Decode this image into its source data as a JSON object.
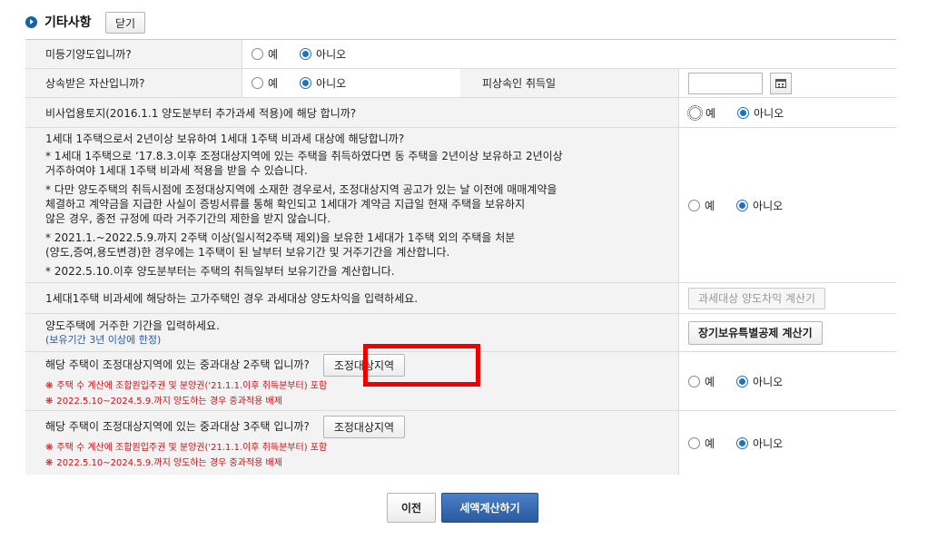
{
  "section": {
    "title": "기타사항",
    "close_label": "닫기"
  },
  "radio": {
    "yes": "예",
    "no": "아니오"
  },
  "rows": [
    {
      "question": "미등기양도입니까?",
      "selected": "no"
    },
    {
      "question": "상속받은 자산입니까?",
      "selected": "no",
      "extra_label": "피상속인 취득일",
      "date_value": ""
    },
    {
      "question": "비사업용토지(2016.1.1 양도분부터 추가과세 적용)에 해당 합니까?",
      "selected": "no"
    },
    {
      "lines": [
        "1세대 1주택으로서 2년이상 보유하여 1세대 1주택 비과세 대상에 해당합니까?",
        "* 1세대 1주택으로 ‘17.8.3.이후 조정대상지역에 있는 주택을 취득하였다면 동 주택을 2년이상 보유하고 2년이상",
        "거주하여야 1세대 1주택 비과세 적용을 받을 수 있습니다.",
        "* 다만 양도주택의 취득시점에 조정대상지역에 소재한 경우로서, 조정대상지역 공고가 있는 날 이전에 매매계약을",
        "체결하고 계약금을 지급한 사실이 증빙서류를 통해 확인되고 1세대가 계약금 지급일 현재 주택을 보유하지",
        "않은 경우, 종전 규정에 따라 거주기간의 제한을 받지 않습니다.",
        "* 2021.1.~2022.5.9.까지 2주택 이상(일시적2주택 제외)을 보유한 1세대가 1주택 외의 주택을 처분",
        "(양도,증여,용도변경)한 경우에는 1주택이 된 날부터 보유기간 및 거주기간을 계산합니다.",
        "* 2022.5.10.이후 양도분부터는 주택의 취득일부터 보유기간을 계산합니다."
      ],
      "selected": "no"
    },
    {
      "question": "1세대1주택 비과세에 해당하는 고가주택인 경우 과세대상 양도차익을 입력하세요.",
      "button": "과세대상 양도차익 계산기"
    },
    {
      "question": "양도주택에 거주한 기간을 입력하세요.",
      "note": "(보유기간 3년 이상에 한정)",
      "button": "장기보유특별공제 계산기"
    },
    {
      "question": "해당 주택이 조정대상지역에 있는 중과대상 2주택 입니까?",
      "button": "조정대상지역",
      "notes": [
        "주택 수 계산에 조합원입주권 및 분양권('21.1.1.이후 취득분부터) 포함",
        "2022.5.10~2024.5.9.까지 양도하는 경우 중과적용 배제"
      ],
      "selected": "no"
    },
    {
      "question": "해당 주택이 조정대상지역에 있는 중과대상 3주택 입니까?",
      "button": "조정대상지역",
      "notes": [
        "주택 수 계산에 조합원입주권 및 분양권('21.1.1.이후 취득분부터) 포함",
        "2022.5.10~2024.5.9.까지 양도하는 경우 중과적용 배제"
      ],
      "selected": "no"
    }
  ],
  "note_marker": "❋",
  "footer": {
    "prev_label": "이전",
    "calc_label": "세액계산하기"
  }
}
